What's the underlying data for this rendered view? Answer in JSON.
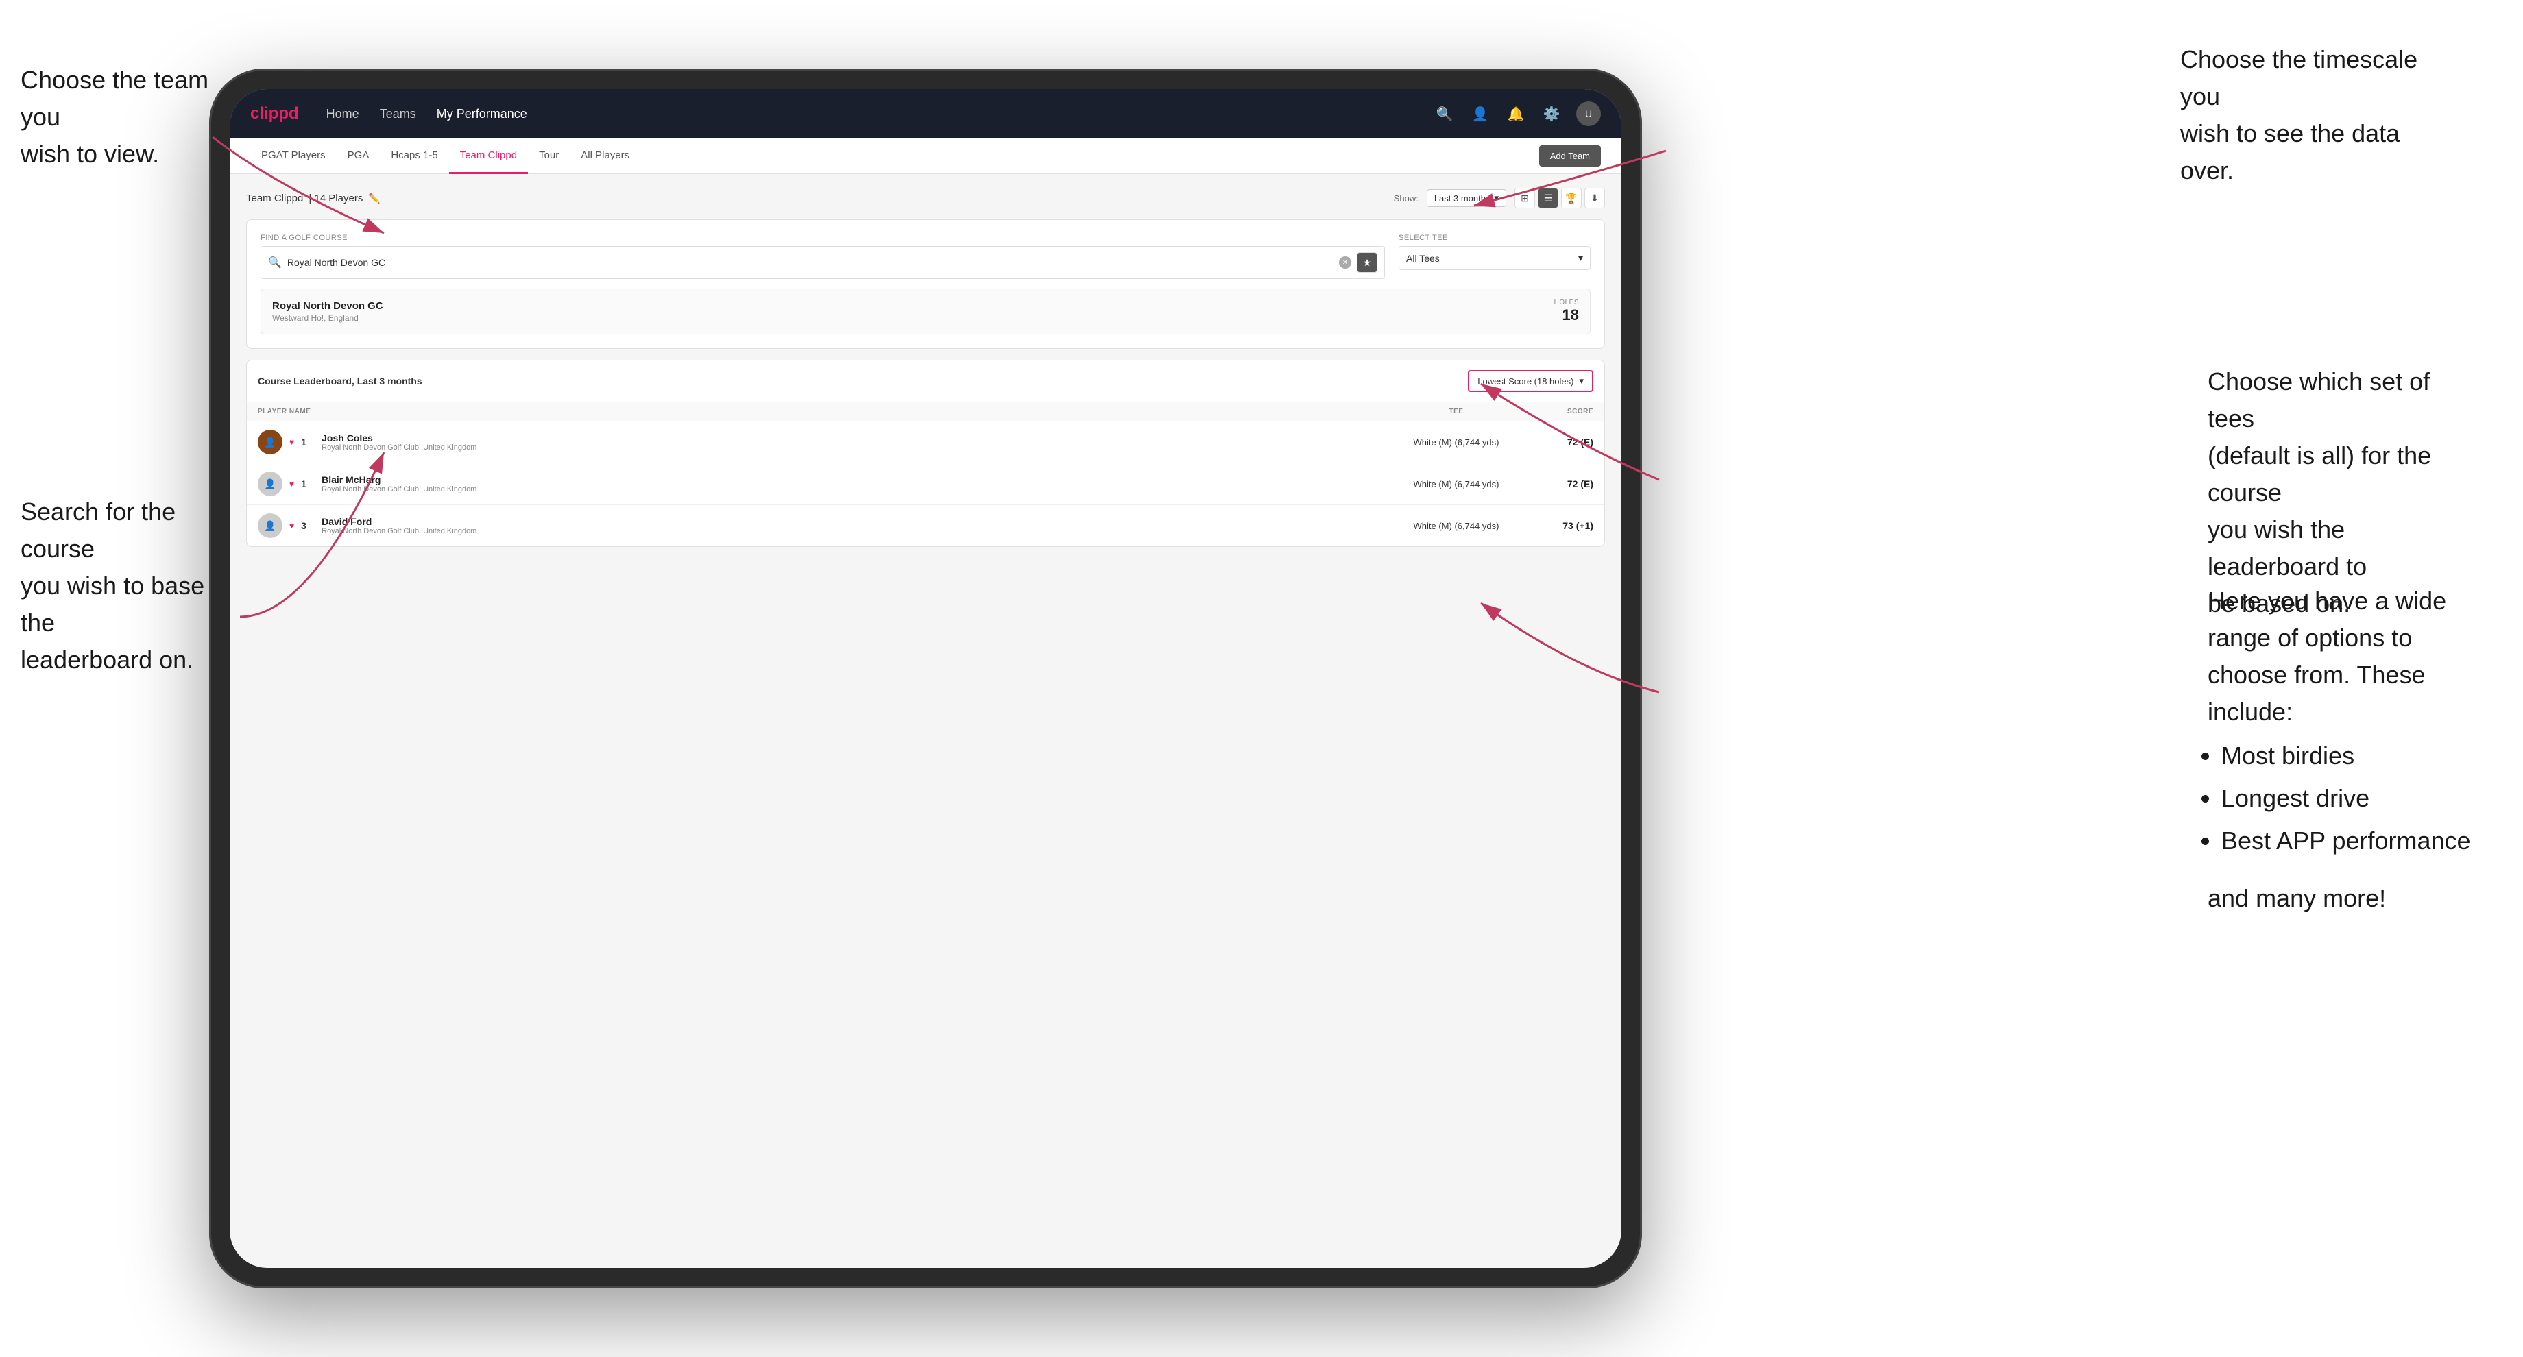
{
  "annotations": {
    "top_left": {
      "line1": "Choose the team you",
      "line2": "wish to view."
    },
    "bottom_left": {
      "line1": "Search for the course",
      "line2": "you wish to base the",
      "line3": "leaderboard on."
    },
    "top_right": {
      "line1": "Choose the timescale you",
      "line2": "wish to see the data over."
    },
    "mid_right": {
      "line1": "Choose which set of tees",
      "line2": "(default is all) for the course",
      "line3": "you wish the leaderboard to",
      "line4": "be based on."
    },
    "bottom_right": {
      "intro": "Here you have a wide range of options to choose from. These include:",
      "bullets": [
        "Most birdies",
        "Longest drive",
        "Best APP performance"
      ],
      "outro": "and many more!"
    }
  },
  "navbar": {
    "logo": "clippd",
    "links": [
      {
        "label": "Home",
        "active": false
      },
      {
        "label": "Teams",
        "active": false
      },
      {
        "label": "My Performance",
        "active": true
      }
    ],
    "icons": [
      "search",
      "person",
      "bell",
      "settings",
      "avatar"
    ]
  },
  "subnav": {
    "items": [
      {
        "label": "PGAT Players",
        "active": false
      },
      {
        "label": "PGA",
        "active": false
      },
      {
        "label": "Hcaps 1-5",
        "active": false
      },
      {
        "label": "Team Clippd",
        "active": true
      },
      {
        "label": "Tour",
        "active": false
      },
      {
        "label": "All Players",
        "active": false
      }
    ],
    "add_team_label": "Add Team"
  },
  "team_header": {
    "title": "Team Clippd",
    "player_count": "14 Players",
    "show_label": "Show:",
    "period": "Last 3 months"
  },
  "search_section": {
    "find_label": "Find a Golf Course",
    "search_placeholder": "Royal North Devon GC",
    "select_tee_label": "Select Tee",
    "tee_value": "All Tees",
    "course_result": {
      "name": "Royal North Devon GC",
      "location": "Westward Ho!, England",
      "holes_label": "Holes",
      "holes_value": "18"
    }
  },
  "leaderboard": {
    "title": "Course Leaderboard,",
    "period": "Last 3 months",
    "score_type": "Lowest Score (18 holes)",
    "columns": {
      "player": "PLAYER NAME",
      "tee": "TEE",
      "score": "SCORE"
    },
    "players": [
      {
        "rank": "1",
        "name": "Josh Coles",
        "club": "Royal North Devon Golf Club, United Kingdom",
        "tee": "White (M) (6,744 yds)",
        "score": "72 (E)"
      },
      {
        "rank": "1",
        "name": "Blair McHarg",
        "club": "Royal North Devon Golf Club, United Kingdom",
        "tee": "White (M) (6,744 yds)",
        "score": "72 (E)"
      },
      {
        "rank": "3",
        "name": "David Ford",
        "club": "Royal North Devon Golf Club, United Kingdom",
        "tee": "White (M) (6,744 yds)",
        "score": "73 (+1)"
      }
    ]
  }
}
